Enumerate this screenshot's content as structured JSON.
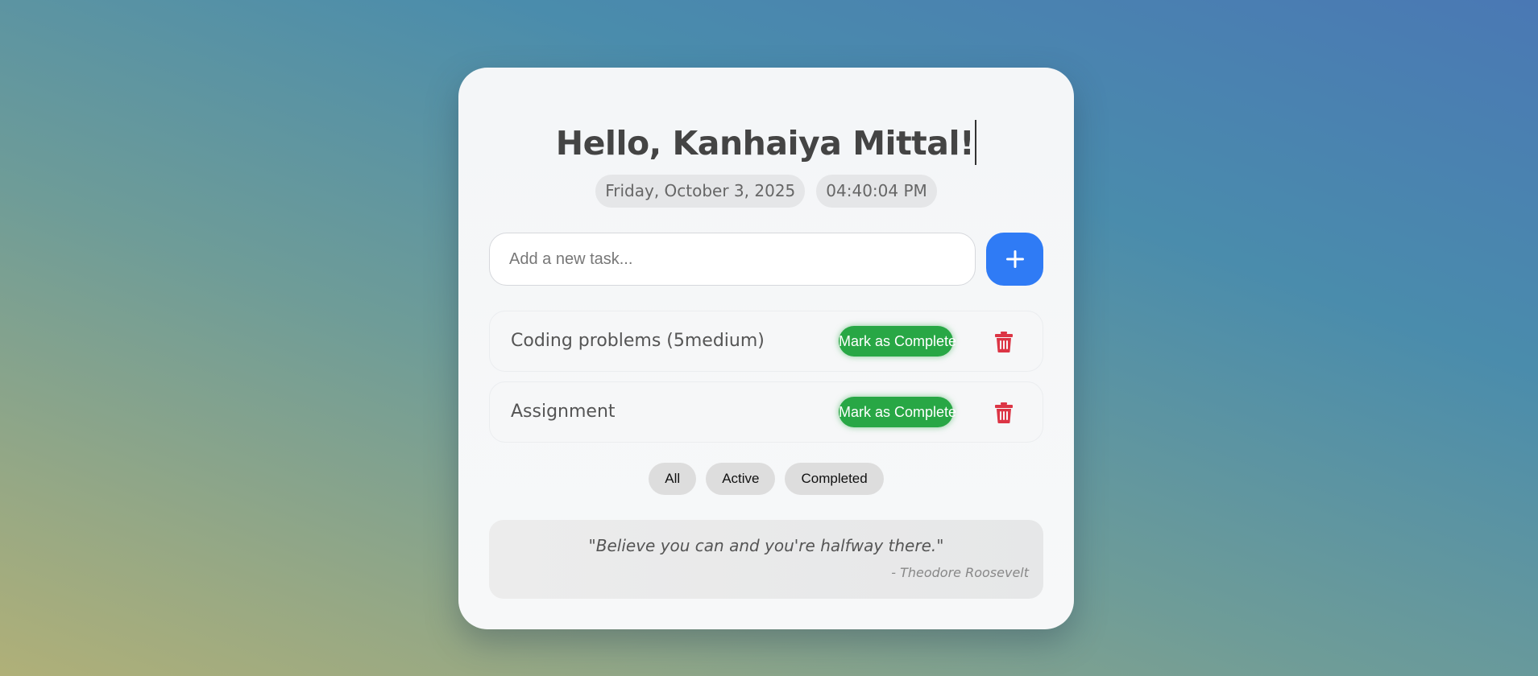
{
  "greeting": "Hello, Kanhaiya Mittal!",
  "date": "Friday, October 3, 2025",
  "time": "04:40:04 PM",
  "new_task": {
    "placeholder": "Add a new task...",
    "value": "",
    "add_icon": "plus-icon"
  },
  "tasks": [
    {
      "label": "Coding problems (5medium)",
      "action_label": "Mark as Complete",
      "delete_icon": "trash-icon"
    },
    {
      "label": "Assignment",
      "action_label": "Mark as Complete",
      "delete_icon": "trash-icon"
    }
  ],
  "filters": [
    "All",
    "Active",
    "Completed"
  ],
  "quote": {
    "text": "\"Believe you can and you're halfway there.\"",
    "author": "- Theodore Roosevelt"
  },
  "colors": {
    "primary": "#2f7bf5",
    "success": "#28a745",
    "danger": "#dc3545"
  }
}
